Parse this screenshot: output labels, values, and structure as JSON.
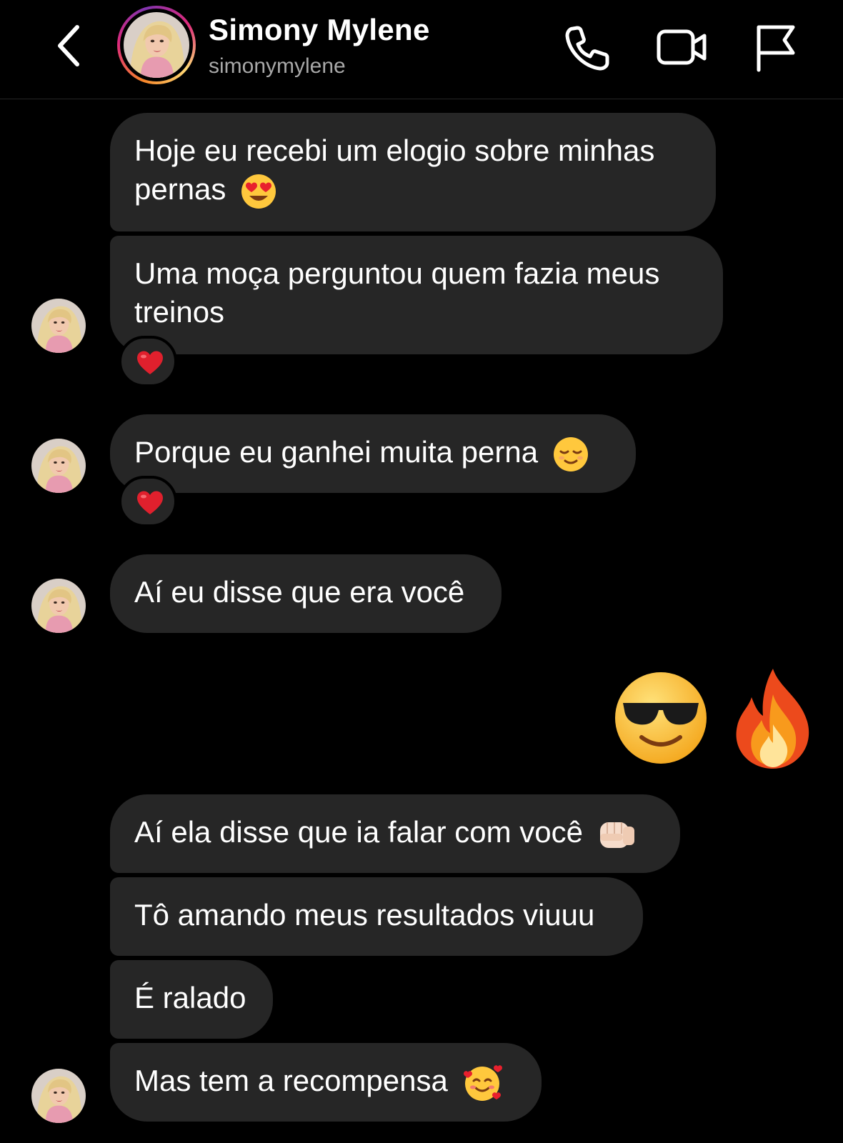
{
  "header": {
    "name": "Simony Mylene",
    "username": "simonymylene",
    "icons": [
      "back-chevron-icon",
      "phone-icon",
      "video-camera-icon",
      "flag-icon"
    ]
  },
  "messages": [
    {
      "text": "Hoje eu recebi um elogio sobre minhas pernas",
      "emoji": "heart-eyes"
    },
    {
      "text": "Uma moça perguntou quem fazia meus treinos",
      "reaction": "red-heart"
    },
    {
      "text": "Porque eu ganhei muita perna",
      "emoji": "relieved-face",
      "reaction": "red-heart"
    },
    {
      "text": "Aí eu disse que era você"
    },
    {
      "sent": true,
      "emojis": [
        "sunglasses-face",
        "fire"
      ]
    },
    {
      "text": "Aí ela disse que ia falar com você",
      "emoji": "fist-bump"
    },
    {
      "text": "Tô amando meus resultados viuuu"
    },
    {
      "text": "É ralado"
    },
    {
      "text": "Mas tem a recompensa",
      "emoji": "smiling-face-with-hearts"
    }
  ],
  "colors": {
    "background": "#000000",
    "bubble": "#262626",
    "muted_text": "#a8a8a8",
    "heart": "#e0202d"
  }
}
